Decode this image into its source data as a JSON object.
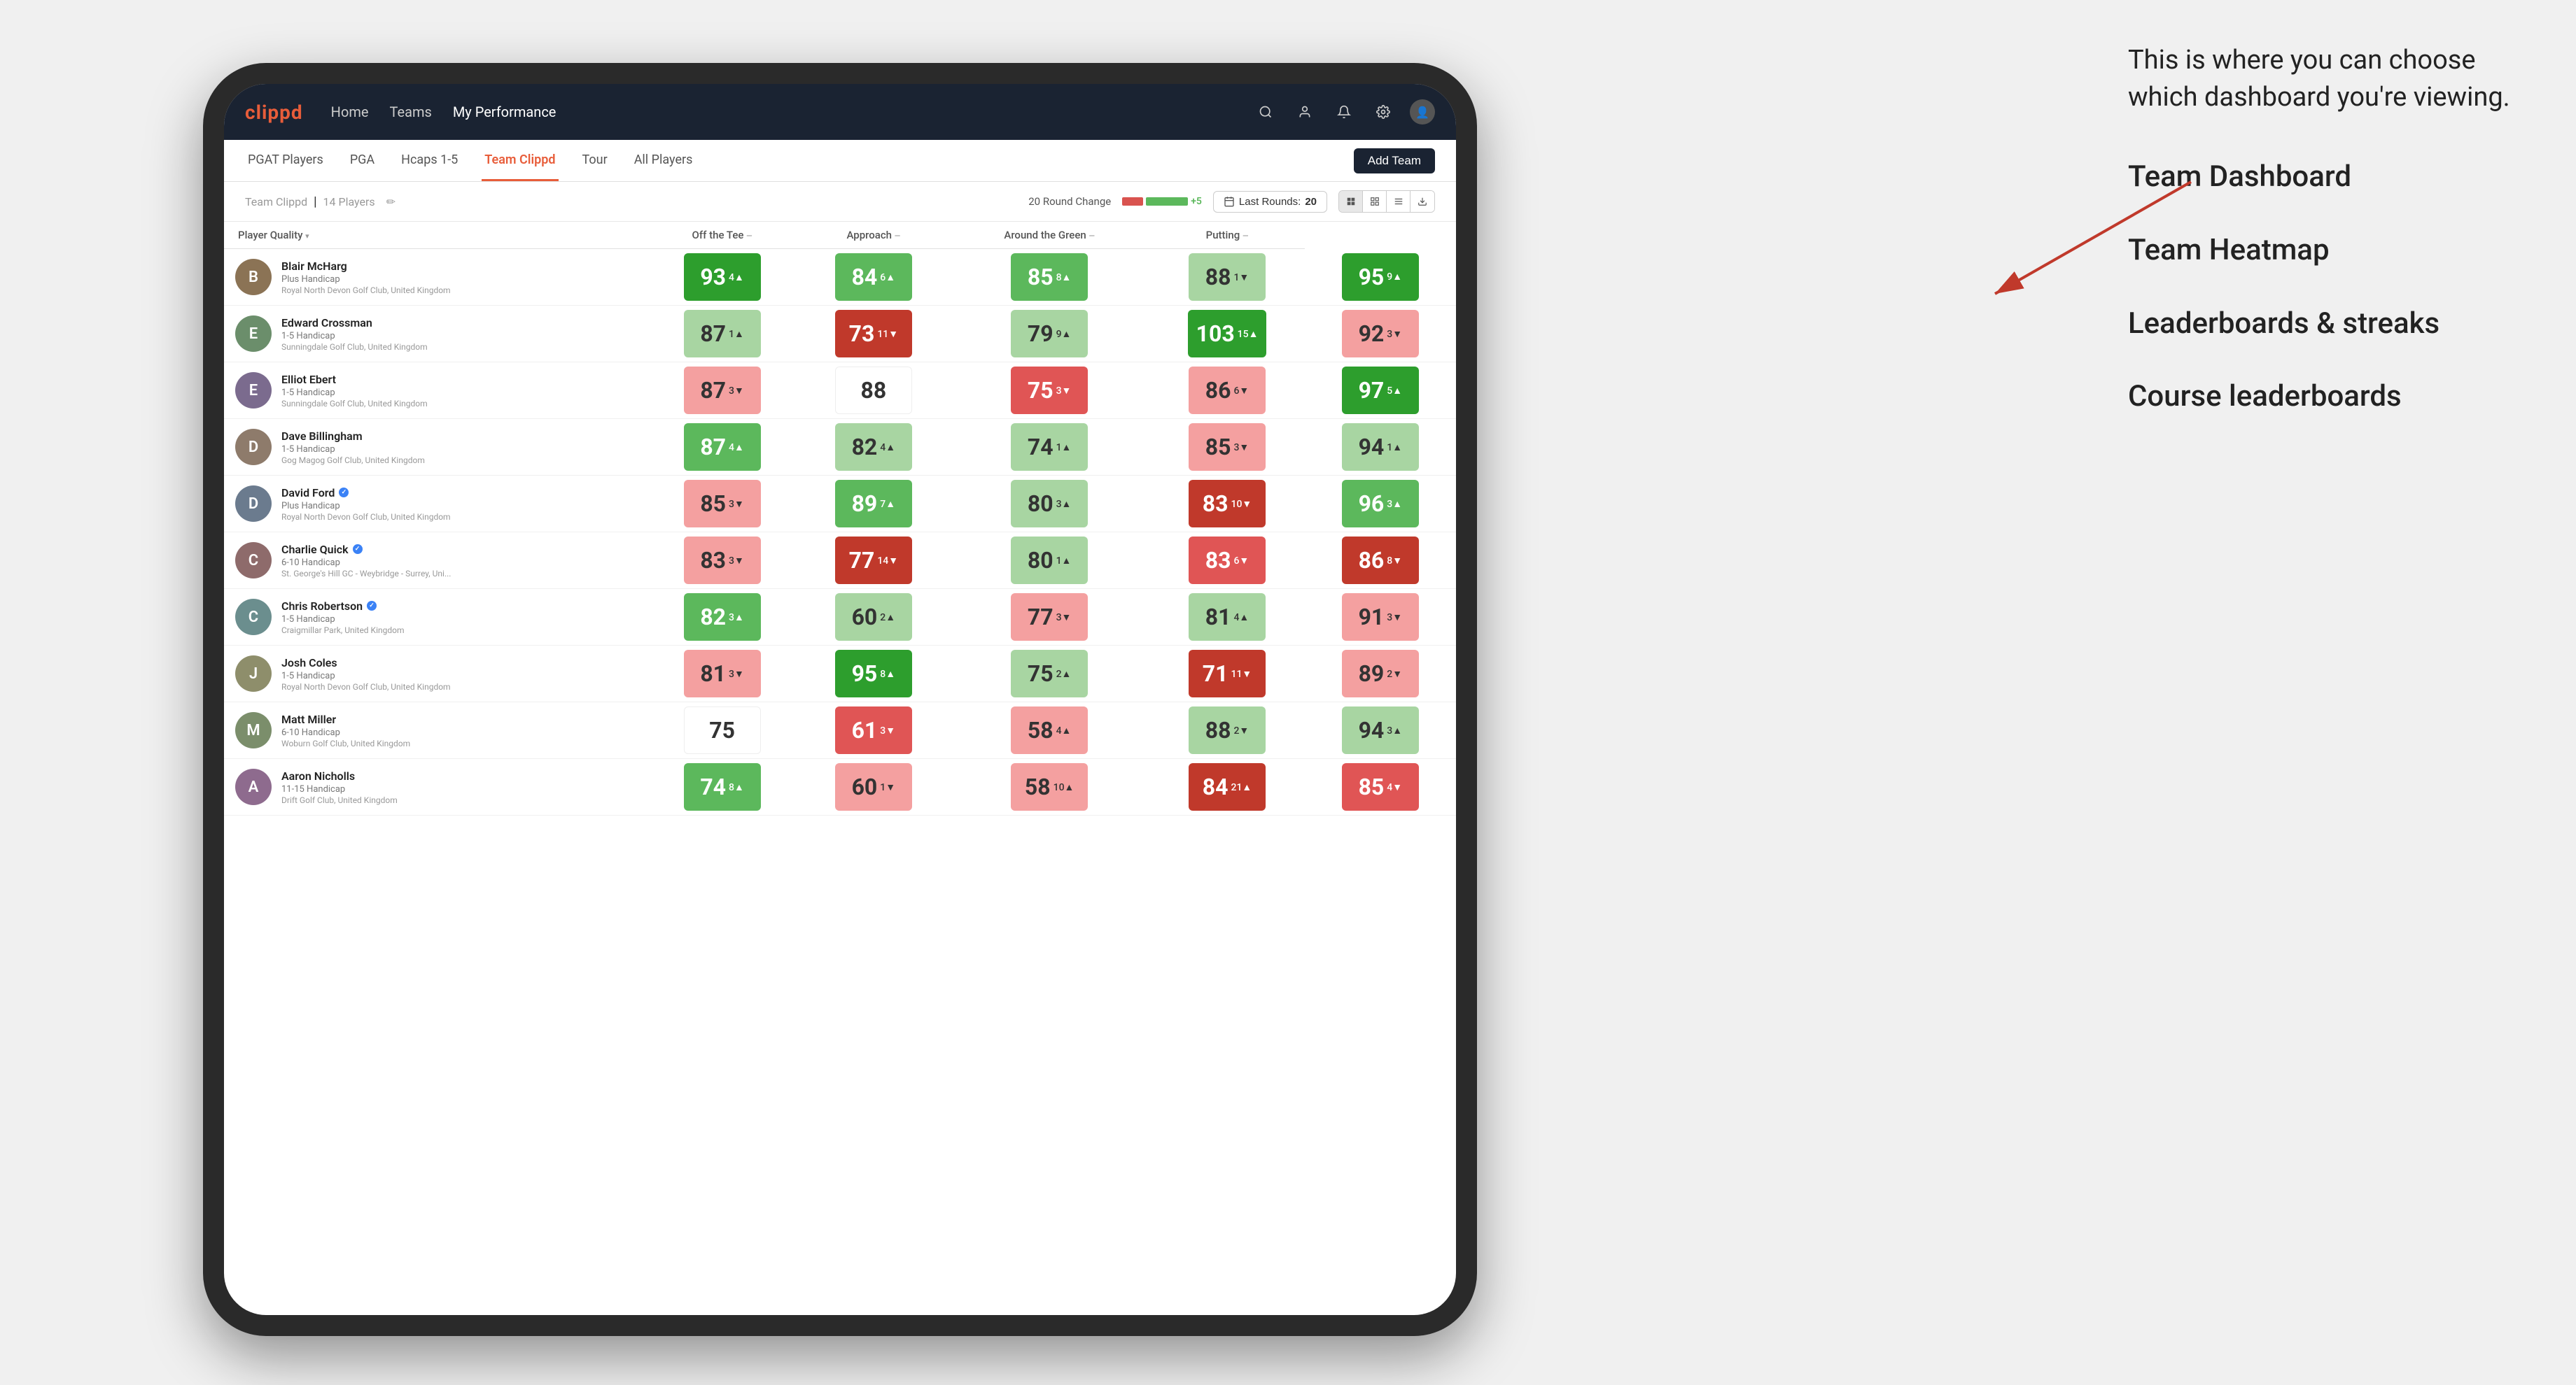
{
  "annotation": {
    "intro_text": "This is where you can choose which dashboard you're viewing.",
    "menu_items": [
      "Team Dashboard",
      "Team Heatmap",
      "Leaderboards & streaks",
      "Course leaderboards"
    ]
  },
  "nav": {
    "logo": "clippd",
    "items": [
      "Home",
      "Teams",
      "My Performance"
    ],
    "active_item": "My Performance"
  },
  "sub_nav": {
    "tabs": [
      "PGAT Players",
      "PGA",
      "Hcaps 1-5",
      "Team Clippd",
      "Tour",
      "All Players"
    ],
    "active_tab": "Team Clippd",
    "add_team_label": "Add Team"
  },
  "team_header": {
    "team_name": "Team Clippd",
    "player_count": "14 Players",
    "round_change_label": "20 Round Change",
    "neg_change": "-5",
    "pos_change": "+5",
    "last_rounds_label": "Last Rounds:",
    "last_rounds_value": "20"
  },
  "table": {
    "columns": [
      {
        "id": "player",
        "label": "Player Quality",
        "sortable": true
      },
      {
        "id": "off_tee",
        "label": "Off the Tee",
        "sortable": true
      },
      {
        "id": "approach",
        "label": "Approach",
        "sortable": true
      },
      {
        "id": "around_green",
        "label": "Around the Green",
        "sortable": true
      },
      {
        "id": "putting",
        "label": "Putting",
        "sortable": true
      }
    ],
    "rows": [
      {
        "name": "Blair McHarg",
        "badge": "",
        "handicap": "Plus Handicap",
        "club": "Royal North Devon Golf Club, United Kingdom",
        "avatar_char": "B",
        "scores": [
          {
            "value": "93",
            "change": "4",
            "dir": "up",
            "color": "green-strong"
          },
          {
            "value": "84",
            "change": "6",
            "dir": "up",
            "color": "green-med"
          },
          {
            "value": "85",
            "change": "8",
            "dir": "up",
            "color": "green-med"
          },
          {
            "value": "88",
            "change": "1",
            "dir": "down",
            "color": "green-light"
          },
          {
            "value": "95",
            "change": "9",
            "dir": "up",
            "color": "green-strong"
          }
        ]
      },
      {
        "name": "Edward Crossman",
        "badge": "",
        "handicap": "1-5 Handicap",
        "club": "Sunningdale Golf Club, United Kingdom",
        "avatar_char": "E",
        "scores": [
          {
            "value": "87",
            "change": "1",
            "dir": "up",
            "color": "green-light"
          },
          {
            "value": "73",
            "change": "11",
            "dir": "down",
            "color": "red-strong"
          },
          {
            "value": "79",
            "change": "9",
            "dir": "up",
            "color": "green-light"
          },
          {
            "value": "103",
            "change": "15",
            "dir": "up",
            "color": "green-strong"
          },
          {
            "value": "92",
            "change": "3",
            "dir": "down",
            "color": "red-light"
          }
        ]
      },
      {
        "name": "Elliot Ebert",
        "badge": "",
        "handicap": "1-5 Handicap",
        "club": "Sunningdale Golf Club, United Kingdom",
        "avatar_char": "E",
        "scores": [
          {
            "value": "87",
            "change": "3",
            "dir": "down",
            "color": "red-light"
          },
          {
            "value": "88",
            "change": "",
            "dir": "",
            "color": "white"
          },
          {
            "value": "75",
            "change": "3",
            "dir": "down",
            "color": "red-med"
          },
          {
            "value": "86",
            "change": "6",
            "dir": "down",
            "color": "red-light"
          },
          {
            "value": "97",
            "change": "5",
            "dir": "up",
            "color": "green-strong"
          }
        ]
      },
      {
        "name": "Dave Billingham",
        "badge": "",
        "handicap": "1-5 Handicap",
        "club": "Gog Magog Golf Club, United Kingdom",
        "avatar_char": "D",
        "scores": [
          {
            "value": "87",
            "change": "4",
            "dir": "up",
            "color": "green-med"
          },
          {
            "value": "82",
            "change": "4",
            "dir": "up",
            "color": "green-light"
          },
          {
            "value": "74",
            "change": "1",
            "dir": "up",
            "color": "green-light"
          },
          {
            "value": "85",
            "change": "3",
            "dir": "down",
            "color": "red-light"
          },
          {
            "value": "94",
            "change": "1",
            "dir": "up",
            "color": "green-light"
          }
        ]
      },
      {
        "name": "David Ford",
        "badge": "verified",
        "handicap": "Plus Handicap",
        "club": "Royal North Devon Golf Club, United Kingdom",
        "avatar_char": "D",
        "scores": [
          {
            "value": "85",
            "change": "3",
            "dir": "down",
            "color": "red-light"
          },
          {
            "value": "89",
            "change": "7",
            "dir": "up",
            "color": "green-med"
          },
          {
            "value": "80",
            "change": "3",
            "dir": "up",
            "color": "green-light"
          },
          {
            "value": "83",
            "change": "10",
            "dir": "down",
            "color": "red-strong"
          },
          {
            "value": "96",
            "change": "3",
            "dir": "up",
            "color": "green-med"
          }
        ]
      },
      {
        "name": "Charlie Quick",
        "badge": "verified",
        "handicap": "6-10 Handicap",
        "club": "St. George's Hill GC - Weybridge - Surrey, Uni...",
        "avatar_char": "C",
        "scores": [
          {
            "value": "83",
            "change": "3",
            "dir": "down",
            "color": "red-light"
          },
          {
            "value": "77",
            "change": "14",
            "dir": "down",
            "color": "red-strong"
          },
          {
            "value": "80",
            "change": "1",
            "dir": "up",
            "color": "green-light"
          },
          {
            "value": "83",
            "change": "6",
            "dir": "down",
            "color": "red-med"
          },
          {
            "value": "86",
            "change": "8",
            "dir": "down",
            "color": "red-strong"
          }
        ]
      },
      {
        "name": "Chris Robertson",
        "badge": "verified",
        "handicap": "1-5 Handicap",
        "club": "Craigmillar Park, United Kingdom",
        "avatar_char": "C",
        "scores": [
          {
            "value": "82",
            "change": "3",
            "dir": "up",
            "color": "green-med"
          },
          {
            "value": "60",
            "change": "2",
            "dir": "up",
            "color": "green-light"
          },
          {
            "value": "77",
            "change": "3",
            "dir": "down",
            "color": "red-light"
          },
          {
            "value": "81",
            "change": "4",
            "dir": "up",
            "color": "green-light"
          },
          {
            "value": "91",
            "change": "3",
            "dir": "down",
            "color": "red-light"
          }
        ]
      },
      {
        "name": "Josh Coles",
        "badge": "",
        "handicap": "1-5 Handicap",
        "club": "Royal North Devon Golf Club, United Kingdom",
        "avatar_char": "J",
        "scores": [
          {
            "value": "81",
            "change": "3",
            "dir": "down",
            "color": "red-light"
          },
          {
            "value": "95",
            "change": "8",
            "dir": "up",
            "color": "green-strong"
          },
          {
            "value": "75",
            "change": "2",
            "dir": "up",
            "color": "green-light"
          },
          {
            "value": "71",
            "change": "11",
            "dir": "down",
            "color": "red-strong"
          },
          {
            "value": "89",
            "change": "2",
            "dir": "down",
            "color": "red-light"
          }
        ]
      },
      {
        "name": "Matt Miller",
        "badge": "",
        "handicap": "6-10 Handicap",
        "club": "Woburn Golf Club, United Kingdom",
        "avatar_char": "M",
        "scores": [
          {
            "value": "75",
            "change": "",
            "dir": "",
            "color": "white"
          },
          {
            "value": "61",
            "change": "3",
            "dir": "down",
            "color": "red-med"
          },
          {
            "value": "58",
            "change": "4",
            "dir": "up",
            "color": "red-light"
          },
          {
            "value": "88",
            "change": "2",
            "dir": "down",
            "color": "green-light"
          },
          {
            "value": "94",
            "change": "3",
            "dir": "up",
            "color": "green-light"
          }
        ]
      },
      {
        "name": "Aaron Nicholls",
        "badge": "",
        "handicap": "11-15 Handicap",
        "club": "Drift Golf Club, United Kingdom",
        "avatar_char": "A",
        "scores": [
          {
            "value": "74",
            "change": "8",
            "dir": "up",
            "color": "green-med"
          },
          {
            "value": "60",
            "change": "1",
            "dir": "down",
            "color": "red-light"
          },
          {
            "value": "58",
            "change": "10",
            "dir": "up",
            "color": "red-light"
          },
          {
            "value": "84",
            "change": "21",
            "dir": "up",
            "color": "red-strong"
          },
          {
            "value": "85",
            "change": "4",
            "dir": "down",
            "color": "red-med"
          }
        ]
      }
    ]
  }
}
